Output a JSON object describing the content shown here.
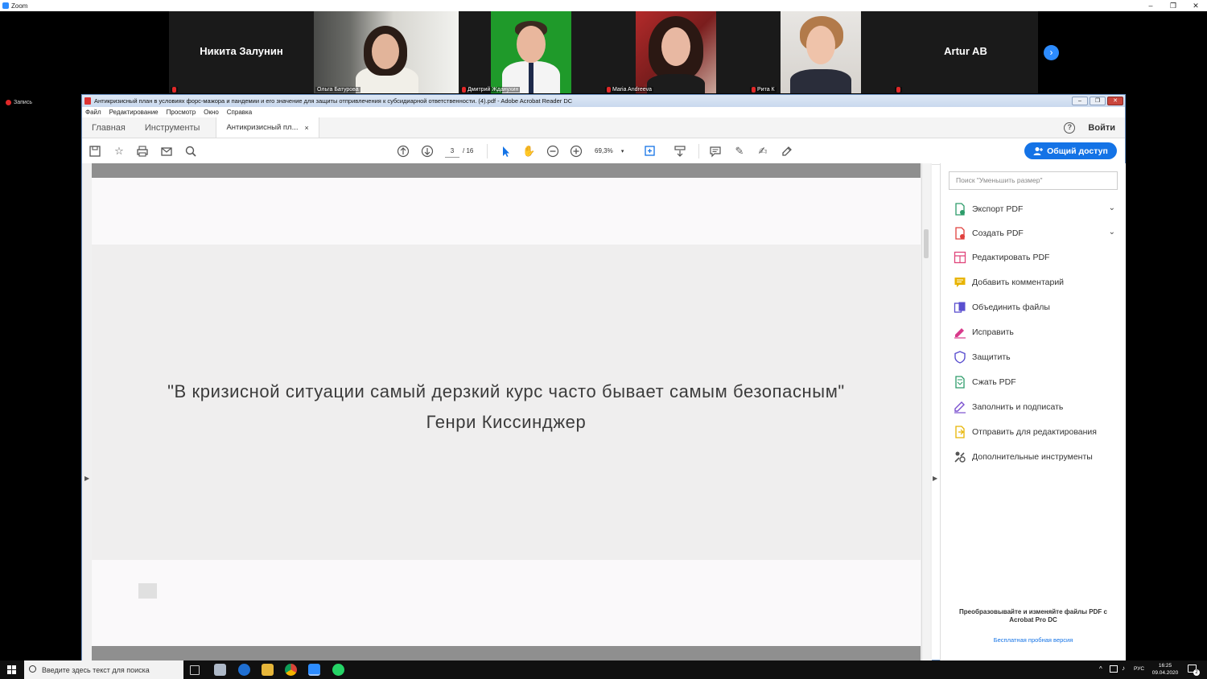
{
  "zoom": {
    "title": "Zoom",
    "window_buttons": [
      "–",
      "❐",
      "✕"
    ],
    "recording_label": "Запись",
    "participants": [
      {
        "name": "Никита Залунин",
        "video": false
      },
      {
        "name": "Ольга Батурова",
        "video": true
      },
      {
        "name": "Дмитрий Жданухин",
        "video": true
      },
      {
        "name": "Maria Andreeva",
        "video": true
      },
      {
        "name": "Рита К",
        "video": true
      },
      {
        "name": "Artur AB",
        "video": false
      }
    ],
    "next_arrow": "›"
  },
  "acrobat": {
    "title": "Антикризисный план в условиях форс-мажора и пандемии и его значение для защиты отпривлечения к субсидиарной ответственности. (4).pdf - Adobe Acrobat Reader DC",
    "menu": [
      "Файл",
      "Редактирование",
      "Просмотр",
      "Окно",
      "Справка"
    ],
    "tabs": {
      "home": "Главная",
      "tools": "Инструменты",
      "doc": "Антикризисный пл...",
      "doc_close": "×"
    },
    "help": "?",
    "login": "Войти",
    "toolbar": {
      "page_current": "3",
      "page_total": "/ 16",
      "zoom": "69,3%",
      "share_label": "Общий доступ"
    },
    "document": {
      "quote_line1": "\"В кризисной ситуации самый дерзкий курс часто бывает самым безопасным\"",
      "quote_line2": "Генри Киссинджер"
    },
    "tools_pane": {
      "search_placeholder": "Поиск \"Уменьшить размер\"",
      "items": [
        {
          "label": "Экспорт PDF",
          "icon": "export-pdf-icon",
          "color": "#2d9c6a",
          "expandable": true
        },
        {
          "label": "Создать PDF",
          "icon": "create-pdf-icon",
          "color": "#e0403d",
          "expandable": true
        },
        {
          "label": "Редактировать PDF",
          "icon": "edit-pdf-icon",
          "color": "#e0457b"
        },
        {
          "label": "Добавить комментарий",
          "icon": "comment-icon",
          "color": "#e8b400"
        },
        {
          "label": "Объединить файлы",
          "icon": "combine-files-icon",
          "color": "#5a4fcf"
        },
        {
          "label": "Исправить",
          "icon": "fix-icon",
          "color": "#d83a8b"
        },
        {
          "label": "Защитить",
          "icon": "protect-icon",
          "color": "#5a4fcf"
        },
        {
          "label": "Сжать PDF",
          "icon": "compress-pdf-icon",
          "color": "#2d9c6a"
        },
        {
          "label": "Заполнить и подписать",
          "icon": "fill-sign-icon",
          "color": "#7a4fcf"
        },
        {
          "label": "Отправить для редактирования",
          "icon": "send-review-icon",
          "color": "#e8b400"
        },
        {
          "label": "Дополнительные инструменты",
          "icon": "more-tools-icon",
          "color": "#555555"
        }
      ],
      "promo": "Преобразовывайте и изменяйте файлы PDF с Acrobat Pro DC",
      "promo_link": "Бесплатная пробная версия"
    }
  },
  "taskbar": {
    "search_placeholder": "Введите здесь текст для поиска",
    "lang": "РУС",
    "time": "16:25",
    "date": "09.04.2020",
    "notifications": "2"
  },
  "colors": {
    "zoom_blue": "#2d8cff",
    "acrobat_share": "#1473e6",
    "active_speaker": "#c5d900"
  }
}
